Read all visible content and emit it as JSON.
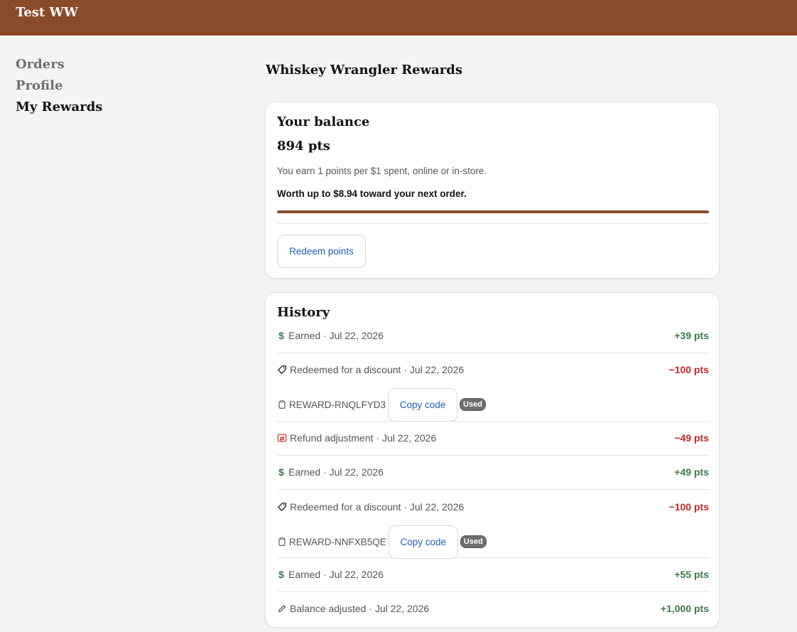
{
  "header": {
    "store_name": "Test WW",
    "brand_color": "#8b4b2b"
  },
  "nav": {
    "items": [
      "Orders",
      "Profile",
      "My Rewards"
    ],
    "active": "My Rewards"
  },
  "page": {
    "title": "Whiskey Wrangler Rewards"
  },
  "balance": {
    "title": "Your balance",
    "points": "894 pts",
    "earn_text": "You earn 1 points per $1 spent, online or in-store.",
    "worth_text": "Worth up to $8.94 toward your next order.",
    "progress_fraction": 1.0,
    "redeem_label": "Redeem points"
  },
  "history": {
    "title": "History",
    "copy_label": "Copy code",
    "used_label": "Used",
    "items": [
      {
        "icon": "dollar-icon",
        "label": "Earned · Jul 22, 2026",
        "amount": "+39 pts",
        "type": "positive"
      },
      {
        "icon": "tag-icon",
        "label": "Redeemed for a discount · Jul 22, 2026",
        "amount": "−100 pts",
        "type": "negative",
        "code": "REWARD-RNQLFYD3"
      },
      {
        "icon": "refund-icon",
        "label": "Refund adjustment · Jul 22, 2026",
        "amount": "−49 pts",
        "type": "negative"
      },
      {
        "icon": "dollar-icon",
        "label": "Earned · Jul 22, 2026",
        "amount": "+49 pts",
        "type": "positive"
      },
      {
        "icon": "tag-icon",
        "label": "Redeemed for a discount · Jul 22, 2026",
        "amount": "−100 pts",
        "type": "negative",
        "code": "REWARD-NNFXB5QE"
      },
      {
        "icon": "dollar-icon",
        "label": "Earned · Jul 22, 2026",
        "amount": "+55 pts",
        "type": "positive"
      },
      {
        "icon": "pencil-icon",
        "label": "Balance adjusted · Jul 22, 2026",
        "amount": "+1,000 pts",
        "type": "positive"
      }
    ]
  }
}
